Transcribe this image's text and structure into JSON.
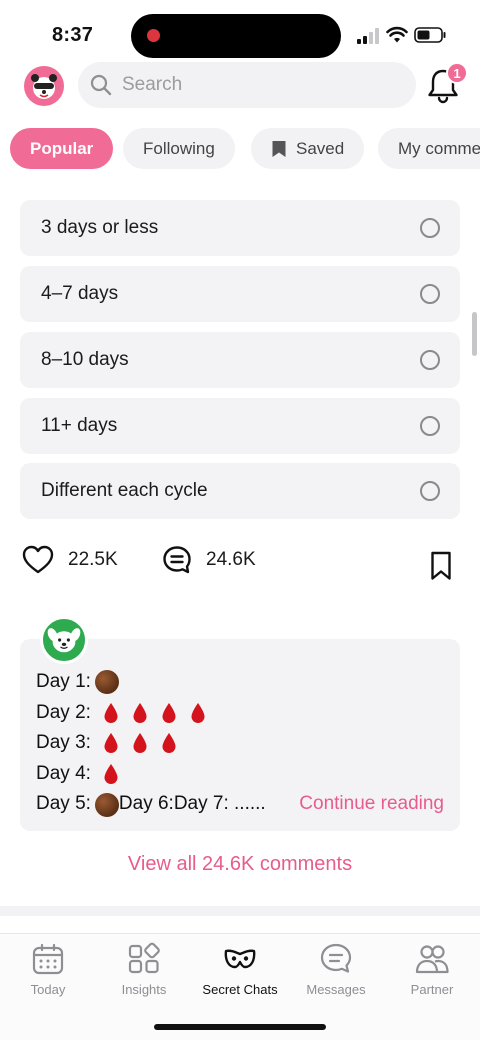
{
  "status_bar": {
    "time": "8:37"
  },
  "header": {
    "search_placeholder": "Search",
    "notification_count": "1"
  },
  "tabs": [
    {
      "label": "Popular",
      "active": true
    },
    {
      "label": "Following",
      "active": false
    },
    {
      "label": "Saved",
      "active": false,
      "icon": "bookmark-icon"
    },
    {
      "label": "My comme",
      "active": false
    }
  ],
  "poll": {
    "options": [
      {
        "label": "3 days or less",
        "selected": false
      },
      {
        "label": "4–7 days",
        "selected": false
      },
      {
        "label": "8–10 days",
        "selected": false
      },
      {
        "label": "11+ days",
        "selected": false
      },
      {
        "label": "Different each cycle",
        "selected": false
      }
    ]
  },
  "actions": {
    "likes": "22.5K",
    "comments": "24.6K"
  },
  "comment": {
    "lines": [
      {
        "prefix": "Day 1:",
        "emoji": "brown-circle",
        "count": 1
      },
      {
        "prefix": "Day 2:",
        "emoji": "drop-of-blood",
        "count": 4
      },
      {
        "prefix": "Day 3:",
        "emoji": "drop-of-blood",
        "count": 3
      },
      {
        "prefix": "Day 4:",
        "emoji": "drop-of-blood",
        "count": 1
      }
    ],
    "last_line_day5": "Day 5:",
    "last_line_rest": "Day 6:Day 7: ......",
    "continue_label": "Continue reading"
  },
  "view_all_label": "View all 24.6K comments",
  "colors": {
    "accent": "#f06b95",
    "link": "#e85c8b",
    "avatar_green": "#2eaa4f"
  },
  "bottom_nav": [
    {
      "label": "Today",
      "icon": "calendar-icon",
      "active": false
    },
    {
      "label": "Insights",
      "icon": "grid-icon",
      "active": false
    },
    {
      "label": "Secret Chats",
      "icon": "mask-icon",
      "active": true
    },
    {
      "label": "Messages",
      "icon": "chat-bubble-icon",
      "active": false
    },
    {
      "label": "Partner",
      "icon": "partner-icon",
      "active": false
    }
  ]
}
